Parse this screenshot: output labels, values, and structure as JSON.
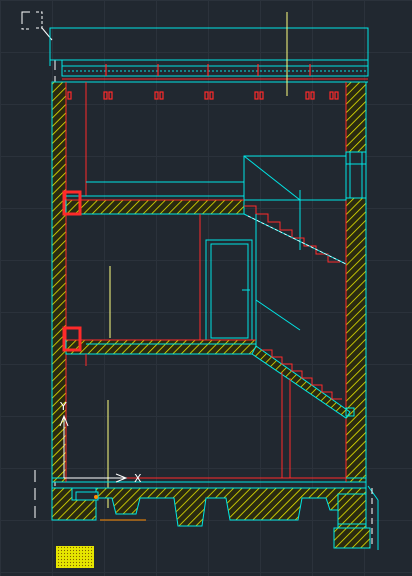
{
  "ucs": {
    "x_axis_label": "X",
    "y_axis_label": "Y"
  },
  "colors": {
    "background": "#212830",
    "grid": "#2b323b",
    "outline": "#00e5e5",
    "wall_red": "#ff2a2a",
    "hatch": "#e6e600",
    "center_line": "#ffff80",
    "white": "#ffffff",
    "orange": "#ff8c00"
  }
}
